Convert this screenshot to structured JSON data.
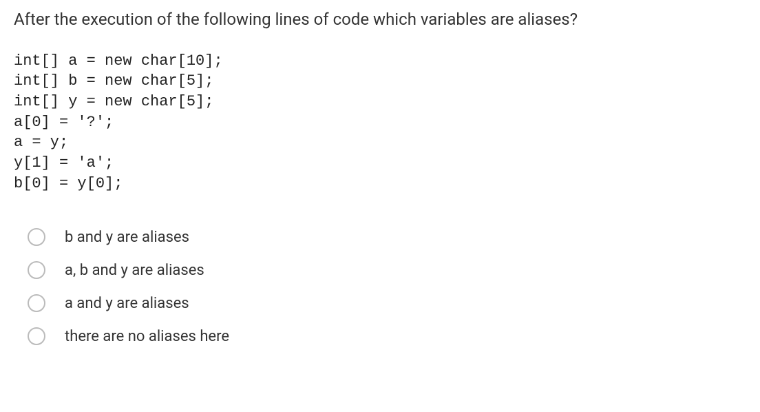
{
  "question": "After the execution of the following lines of code which variables are aliases?",
  "code": "int[] a = new char[10];\nint[] b = new char[5];\nint[] y = new char[5];\na[0] = '?';\na = y;\ny[1] = 'a';\nb[0] = y[0];",
  "options": [
    {
      "label": "b and y are aliases"
    },
    {
      "label": "a, b and y are aliases"
    },
    {
      "label": "a and y are aliases"
    },
    {
      "label": "there are no aliases here"
    }
  ]
}
